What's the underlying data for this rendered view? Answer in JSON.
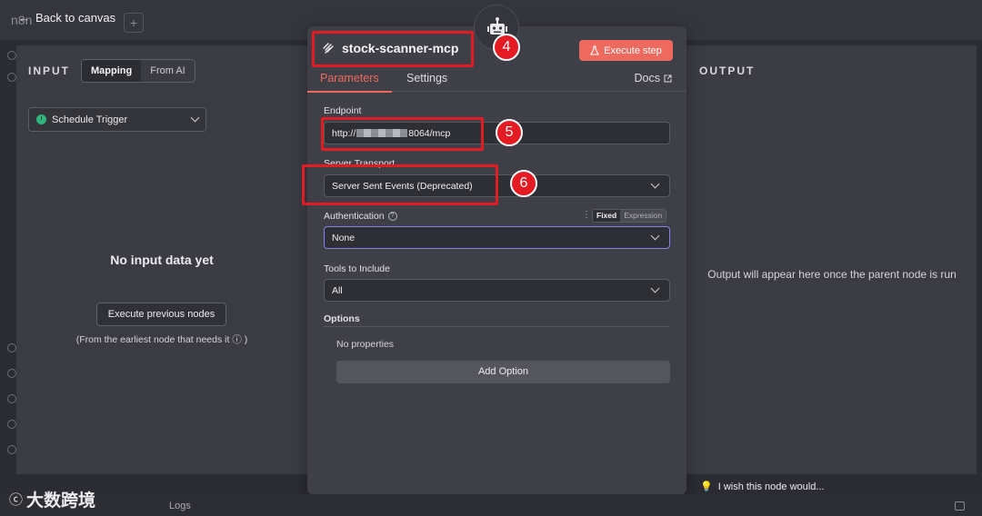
{
  "canvas": {
    "back_label": "Back to canvas",
    "logs_label": "Logs",
    "bg_logo": "n8n",
    "plus": "+"
  },
  "input": {
    "title": "INPUT",
    "tabs": [
      "Mapping",
      "From AI"
    ],
    "active_tab": "Mapping",
    "trigger_select": "Schedule Trigger",
    "empty_title": "No input data yet",
    "execute_previous": "Execute previous nodes",
    "hint": "(From the earliest node that needs it ⓘ )"
  },
  "node": {
    "title": "stock-scanner-mcp",
    "execute_step": "Execute step",
    "tabs": {
      "parameters": "Parameters",
      "settings": "Settings",
      "docs": "Docs"
    },
    "endpoint": {
      "label": "Endpoint",
      "value_prefix": "http://",
      "value_suffix": "8064/mcp"
    },
    "server_transport": {
      "label": "Server Transport",
      "value": "Server Sent Events (Deprecated)"
    },
    "authentication": {
      "label": "Authentication",
      "mode_fixed": "Fixed",
      "mode_expression": "Expression",
      "value": "None"
    },
    "tools_to_include": {
      "label": "Tools to Include",
      "value": "All"
    },
    "options": {
      "label": "Options",
      "empty": "No properties",
      "add_option": "Add Option"
    }
  },
  "output": {
    "title": "OUTPUT",
    "message": "Output will appear here once the parent node is run"
  },
  "footer": {
    "wish": "I wish this node would..."
  },
  "annotations": {
    "badge_4": "4",
    "badge_5": "5",
    "badge_6": "6",
    "color": "#e51b23"
  },
  "watermark": {
    "text": "大数跨境"
  },
  "colors": {
    "accent": "#ee6a5e",
    "focus": "#8a80e8",
    "trigger_green": "#2fb57d"
  }
}
